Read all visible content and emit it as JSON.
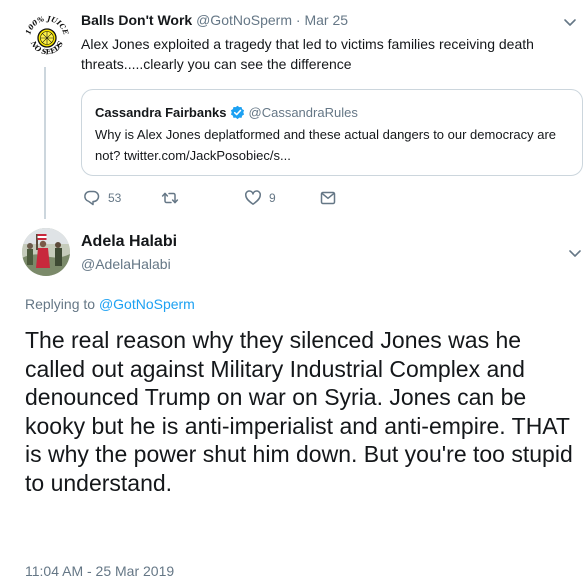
{
  "parent_tweet": {
    "name": "Balls Don't Work",
    "handle": "@GotNoSperm",
    "separator": "·",
    "date": "Mar 25",
    "text": "Alex Jones exploited a tragedy that led to victims families receiving death threats.....clearly you can see the difference",
    "avatar_top_text": "100% JUICE",
    "avatar_bottom_text": "NO SEEDS",
    "quote": {
      "name": "Cassandra Fairbanks",
      "handle": "@CassandraRules",
      "text": "Why is Alex Jones deplatformed and these actual dangers to our democracy are not? twitter.com/JackPosobiec/s..."
    },
    "actions": {
      "reply_count": "53",
      "like_count": "9"
    }
  },
  "main_tweet": {
    "name": "Adela Halabi",
    "handle": "@AdelaHalabi",
    "replying_prefix": "Replying to",
    "replying_to": "@GotNoSperm",
    "text": "The real reason why they silenced Jones was he called out against Military Industrial Complex and denounced Trump on war on Syria. Jones can be kooky but he is anti-imperialist and anti-empire. THAT is why the power shut him down. But you're too stupid to understand.",
    "timestamp": "11:04 AM - 25 Mar 2019"
  },
  "icons": {
    "reply": "reply-icon",
    "retweet": "retweet-icon",
    "like": "heart-icon",
    "dm": "envelope-icon",
    "more": "chevron-down-icon",
    "verified": "verified-badge-icon"
  },
  "colors": {
    "link": "#1da1f2",
    "secondary_text": "#657786",
    "border": "#ccd6dd",
    "verified": "#1da1f2"
  }
}
